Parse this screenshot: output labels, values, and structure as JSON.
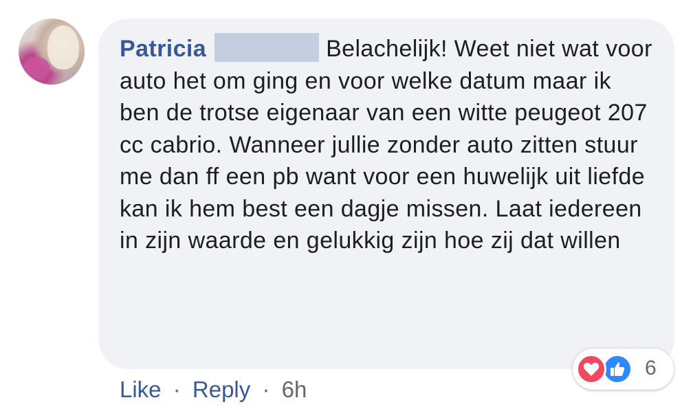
{
  "comment": {
    "author": "Patricia",
    "text": "Belachelijk! Weet niet wat voor auto het om ging en voor welke datum maar ik ben de trotse eigenaar van een witte peugeot 207 cc cabrio. Wanneer jullie zonder auto zitten stuur me dan ff een pb want voor een huwelijk uit liefde kan ik hem best een dagje missen. Laat iedereen in zijn waarde en gelukkig zijn hoe zij dat willen"
  },
  "actions": {
    "like_label": "Like",
    "separator": "·",
    "reply_label": "Reply",
    "timestamp": "6h"
  },
  "reactions": {
    "icons": [
      "love-icon",
      "like-icon"
    ],
    "count": "6"
  },
  "colors": {
    "author_link": "#385898",
    "bubble_bg": "#f0f2f5",
    "love": "#f0485d",
    "like": "#2e89ff",
    "meta_text": "#606770"
  }
}
